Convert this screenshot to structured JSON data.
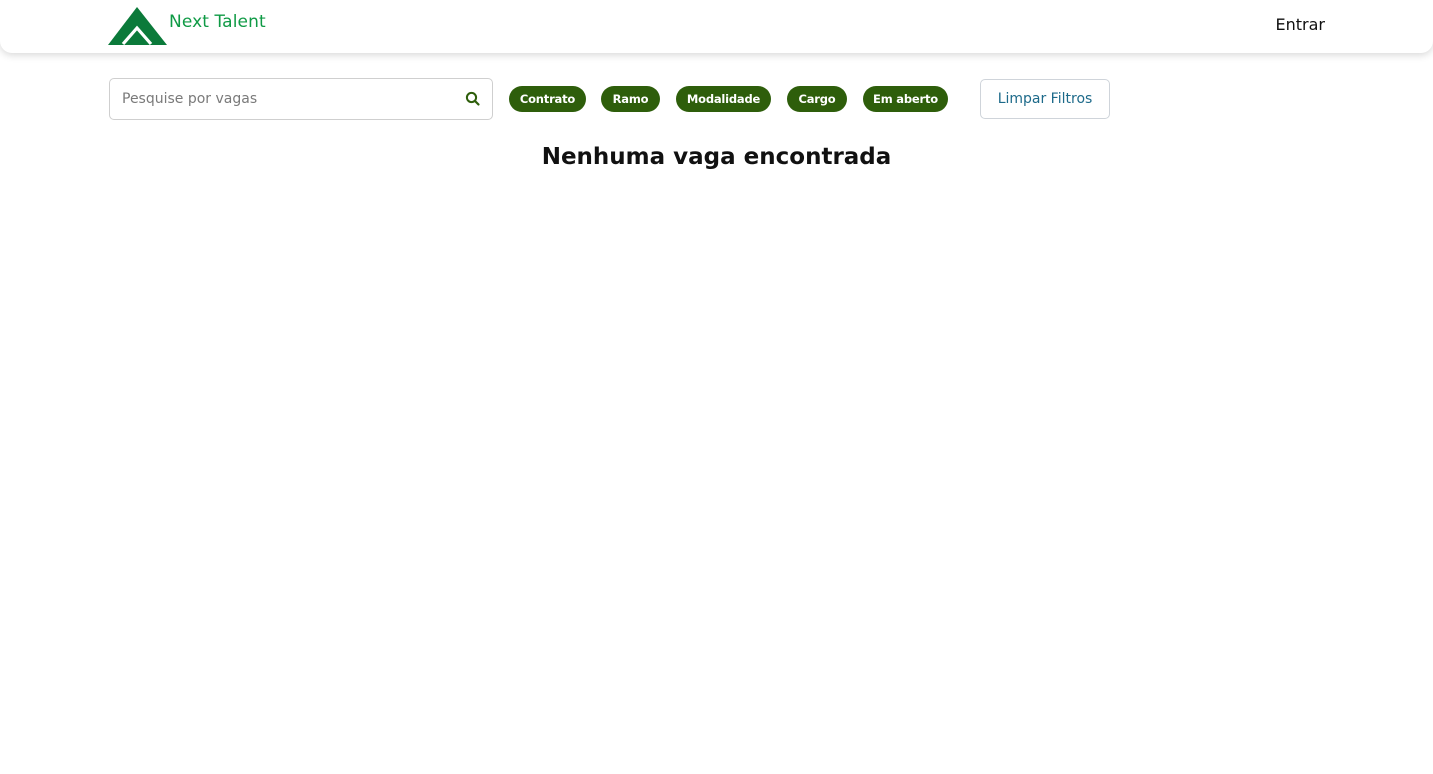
{
  "header": {
    "brand_name": "Next Talent",
    "login_label": "Entrar"
  },
  "search": {
    "placeholder": "Pesquise por vagas",
    "value": ""
  },
  "filters": {
    "chips": [
      "Contrato",
      "Ramo",
      "Modalidade",
      "Cargo",
      "Em aberto"
    ],
    "clear_label": "Limpar Filtros"
  },
  "results": {
    "empty_message": "Nenhuma vaga encontrada"
  },
  "icons": {
    "logo": "mountain-logo-icon",
    "search": "search-icon"
  },
  "colors": {
    "brand_green": "#0f9a45",
    "logo_green": "#0b7a3a",
    "chip_green": "#2e5e0b",
    "clear_text": "#1d6a8a"
  }
}
